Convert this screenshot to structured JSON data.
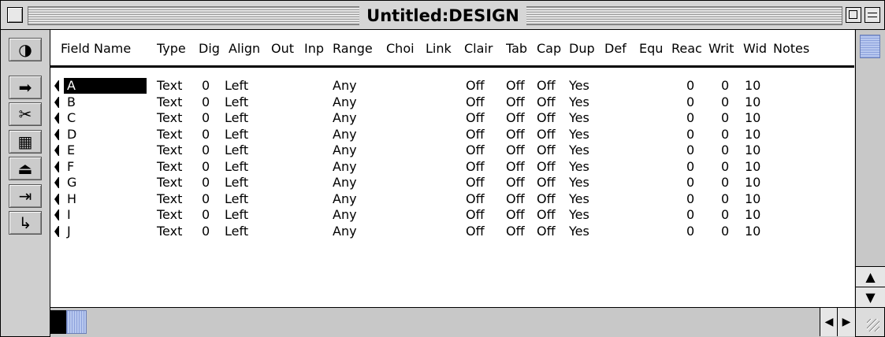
{
  "window": {
    "title": "Untitled:DESIGN"
  },
  "palette": {
    "tools": [
      {
        "name": "design-mode-icon",
        "glyph": "◑"
      },
      {
        "name": "pointer-tool-icon",
        "glyph": "➡"
      },
      {
        "name": "scissors-icon",
        "glyph": "✂"
      },
      {
        "name": "folder-icon",
        "glyph": "▦"
      },
      {
        "name": "stamp-icon",
        "glyph": "⏏"
      },
      {
        "name": "tab-right-icon",
        "glyph": "⇥"
      },
      {
        "name": "return-icon",
        "glyph": "↳"
      }
    ]
  },
  "columns": [
    "Field Name",
    "Type",
    "Dig",
    "Align",
    "Out",
    "Inp",
    "Range",
    "Choi",
    "Link",
    "Clair",
    "Tab",
    "Cap",
    "Dup",
    "Def",
    "Equ",
    "Reac",
    "Writ",
    "Wid",
    "Notes"
  ],
  "rows": [
    {
      "name": "A",
      "type": "Text",
      "dig": "0",
      "align": "Left",
      "range": "Any",
      "clair": "Off",
      "tab": "Off",
      "cap": "Off",
      "dup": "Yes",
      "reac": "0",
      "writ": "0",
      "wid": "10"
    },
    {
      "name": "B",
      "type": "Text",
      "dig": "0",
      "align": "Left",
      "range": "Any",
      "clair": "Off",
      "tab": "Off",
      "cap": "Off",
      "dup": "Yes",
      "reac": "0",
      "writ": "0",
      "wid": "10"
    },
    {
      "name": "C",
      "type": "Text",
      "dig": "0",
      "align": "Left",
      "range": "Any",
      "clair": "Off",
      "tab": "Off",
      "cap": "Off",
      "dup": "Yes",
      "reac": "0",
      "writ": "0",
      "wid": "10"
    },
    {
      "name": "D",
      "type": "Text",
      "dig": "0",
      "align": "Left",
      "range": "Any",
      "clair": "Off",
      "tab": "Off",
      "cap": "Off",
      "dup": "Yes",
      "reac": "0",
      "writ": "0",
      "wid": "10"
    },
    {
      "name": "E",
      "type": "Text",
      "dig": "0",
      "align": "Left",
      "range": "Any",
      "clair": "Off",
      "tab": "Off",
      "cap": "Off",
      "dup": "Yes",
      "reac": "0",
      "writ": "0",
      "wid": "10"
    },
    {
      "name": "F",
      "type": "Text",
      "dig": "0",
      "align": "Left",
      "range": "Any",
      "clair": "Off",
      "tab": "Off",
      "cap": "Off",
      "dup": "Yes",
      "reac": "0",
      "writ": "0",
      "wid": "10"
    },
    {
      "name": "G",
      "type": "Text",
      "dig": "0",
      "align": "Left",
      "range": "Any",
      "clair": "Off",
      "tab": "Off",
      "cap": "Off",
      "dup": "Yes",
      "reac": "0",
      "writ": "0",
      "wid": "10"
    },
    {
      "name": "H",
      "type": "Text",
      "dig": "0",
      "align": "Left",
      "range": "Any",
      "clair": "Off",
      "tab": "Off",
      "cap": "Off",
      "dup": "Yes",
      "reac": "0",
      "writ": "0",
      "wid": "10"
    },
    {
      "name": "I",
      "type": "Text",
      "dig": "0",
      "align": "Left",
      "range": "Any",
      "clair": "Off",
      "tab": "Off",
      "cap": "Off",
      "dup": "Yes",
      "reac": "0",
      "writ": "0",
      "wid": "10"
    },
    {
      "name": "J",
      "type": "Text",
      "dig": "0",
      "align": "Left",
      "range": "Any",
      "clair": "Off",
      "tab": "Off",
      "cap": "Off",
      "dup": "Yes",
      "reac": "0",
      "writ": "0",
      "wid": "10"
    }
  ],
  "selected_row": "A",
  "colors": {
    "selection": "#000000",
    "scroll_thumb": "#b8c8ef"
  }
}
